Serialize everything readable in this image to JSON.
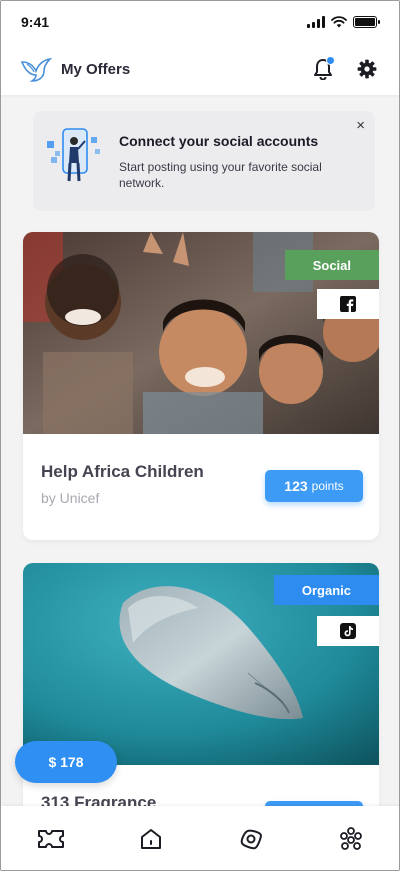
{
  "status_bar": {
    "time": "9:41"
  },
  "header": {
    "title": "My Offers",
    "logo_icon": "dove-icon",
    "notification_icon": "bell-icon",
    "settings_icon": "gear-icon"
  },
  "promo": {
    "title": "Connect your social accounts",
    "subtitle": "Start posting using your favorite social network.",
    "close_label": "×"
  },
  "offers": [
    {
      "category": "Social",
      "category_color": "#58a05c",
      "network_icon": "facebook-icon",
      "title": "Help Africa Children",
      "by": "by Unicef",
      "points": "123",
      "points_unit": "points"
    },
    {
      "category": "Organic",
      "category_color": "#2e8cf0",
      "network_icon": "tiktok-icon",
      "title": "313 Fragrance",
      "by": "",
      "points": "",
      "points_unit": ""
    }
  ],
  "price_pill": {
    "label": "$ 178"
  },
  "tabs": [
    {
      "icon": "ticket-icon"
    },
    {
      "icon": "home-icon"
    },
    {
      "icon": "compass-icon"
    },
    {
      "icon": "community-icon"
    }
  ],
  "colors": {
    "accent": "#2e8cf0",
    "social_tag": "#58a05c",
    "background": "#f3f3f4"
  }
}
